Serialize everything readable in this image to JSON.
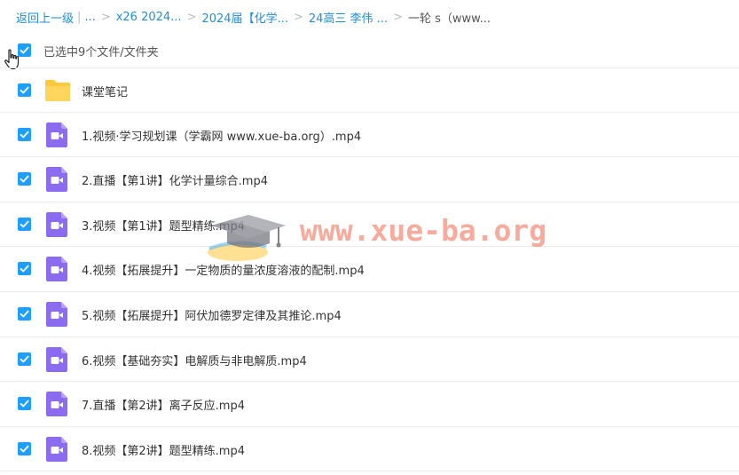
{
  "breadcrumb": {
    "back": "返回上一级",
    "bar": "|",
    "ellipsis": "...",
    "sep": ">",
    "items": [
      "x26 2024...",
      "2024届【化学...",
      "24高三 李伟 ..."
    ],
    "current": "一轮 s（www..."
  },
  "selection": {
    "text": "已选中9个文件/文件夹"
  },
  "files": [
    {
      "name": "课堂笔记",
      "icon": "folder-icon",
      "checked": true
    },
    {
      "name": "1.视频·学习规划课（学霸网 www.xue-ba.org）.mp4",
      "icon": "video-file-icon",
      "checked": true
    },
    {
      "name": "2.直播【第1讲】化学计量综合.mp4",
      "icon": "video-file-icon",
      "checked": true
    },
    {
      "name": "3.视频【第1讲】题型精练.mp4",
      "icon": "video-file-icon",
      "checked": true
    },
    {
      "name": "4.视频【拓展提升】一定物质的量浓度溶液的配制.mp4",
      "icon": "video-file-icon",
      "checked": true
    },
    {
      "name": "5.视频【拓展提升】阿伏加德罗定律及其推论.mp4",
      "icon": "video-file-icon",
      "checked": true
    },
    {
      "name": "6.视频【基础夯实】电解质与非电解质.mp4",
      "icon": "video-file-icon",
      "checked": true
    },
    {
      "name": "7.直播【第2讲】离子反应.mp4",
      "icon": "video-file-icon",
      "checked": true
    },
    {
      "name": "8.视频【第2讲】题型精练.mp4",
      "icon": "video-file-icon",
      "checked": true
    }
  ],
  "watermark": {
    "text": "www.xue-ba.org"
  },
  "colors": {
    "accent": "#1e9fff",
    "link": "#1f8ee0",
    "folder": "#ffc83d",
    "video": "#8b6cf0"
  }
}
